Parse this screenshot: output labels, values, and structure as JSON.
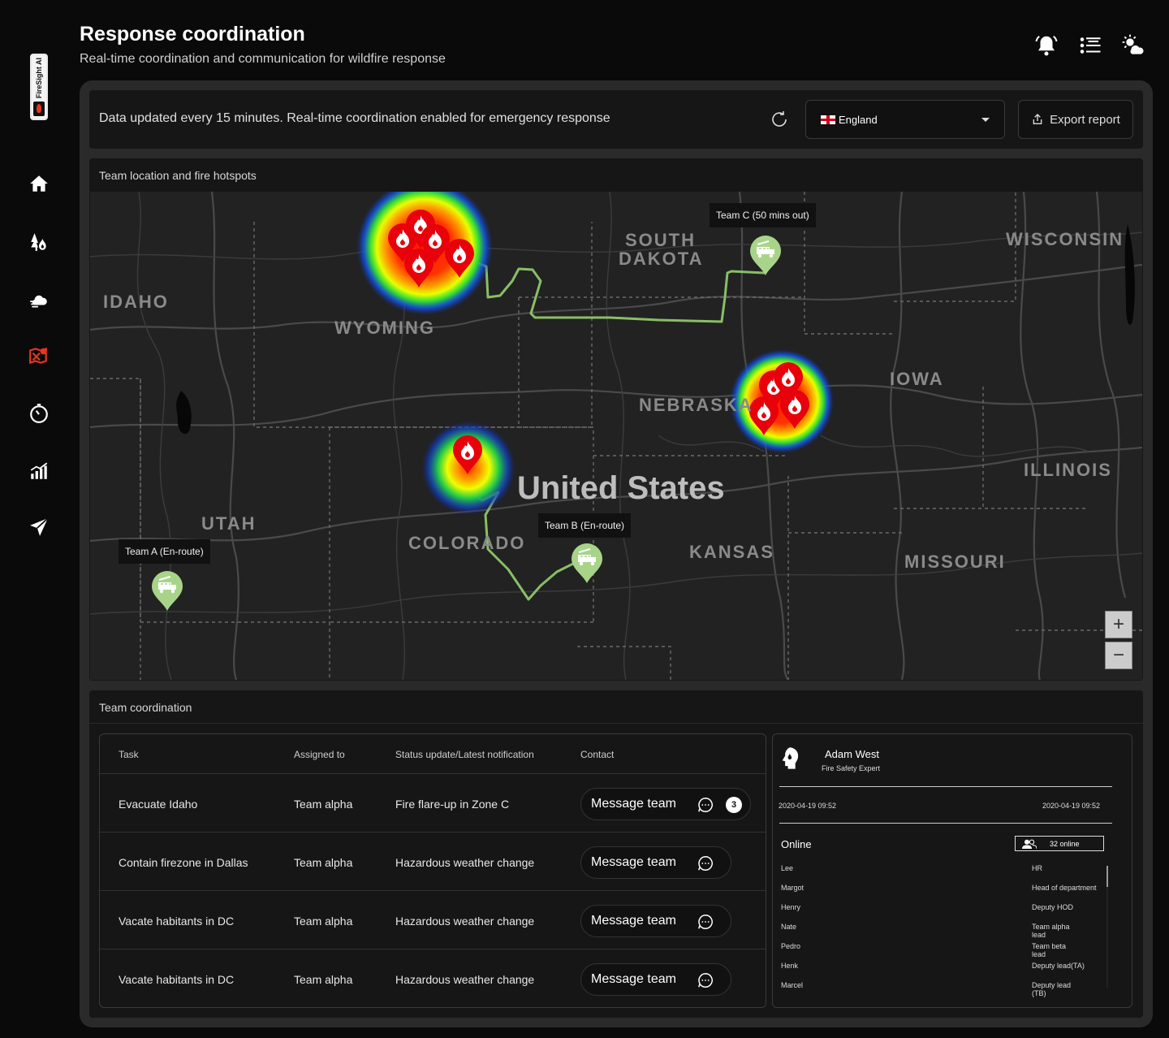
{
  "brand": {
    "name": "FireSight AI"
  },
  "header": {
    "title": "Response coordination",
    "subtitle": "Real-time coordination and communication for wildfire response"
  },
  "nav": [
    "home",
    "fire-risk",
    "weather",
    "response-map",
    "history",
    "analytics",
    "dispatch"
  ],
  "top_icons": [
    "bell-icon",
    "list-icon",
    "weather-icon"
  ],
  "info_bar": {
    "text": "Data updated every 15 minutes. Real-time coordination enabled for emergency response",
    "country": "England",
    "export_label": "Export report"
  },
  "map": {
    "title": "Team location and fire hotspots",
    "country_label": "United States",
    "states": [
      {
        "name": "IDAHO"
      },
      {
        "name": "WYOMING"
      },
      {
        "name": "SOUTH"
      },
      {
        "name": "DAKOTA"
      },
      {
        "name": "WISCONSIN"
      },
      {
        "name": "IOWA"
      },
      {
        "name": "NEBRASKA"
      },
      {
        "name": "ILLINOIS"
      },
      {
        "name": "UTAH"
      },
      {
        "name": "COLORADO"
      },
      {
        "name": "KANSAS"
      },
      {
        "name": "MISSOURI"
      }
    ],
    "teams": [
      {
        "label": "Team A (En-route)"
      },
      {
        "label": "Team B (En-route)"
      },
      {
        "label": "Team C (50 mins out)"
      }
    ],
    "zoom_in": "+",
    "zoom_out": "−"
  },
  "coordination": {
    "title": "Team coordination",
    "columns": [
      "Task",
      "Assigned to",
      "Status update/Latest notification",
      "Contact"
    ],
    "rows": [
      {
        "task": "Evacuate Idaho",
        "assigned": "Team alpha",
        "status": "Fire flare-up in Zone C",
        "contact": "Message team",
        "badge": "3"
      },
      {
        "task": "Contain firezone in Dallas",
        "assigned": "Team alpha",
        "status": "Hazardous weather change",
        "contact": "Message team"
      },
      {
        "task": "Vacate habitants in DC",
        "assigned": "Team alpha",
        "status": "Hazardous weather change",
        "contact": "Message team"
      },
      {
        "task": "Vacate habitants in DC",
        "assigned": "Team alpha",
        "status": "Hazardous weather change",
        "contact": "Message team"
      }
    ]
  },
  "profile": {
    "name": "Adam West",
    "role": "Fire Safety Expert",
    "date_left": "2020-04-19 09:52",
    "date_right": "2020-04-19 09:52",
    "online_title": "Online",
    "online_count": "32 online",
    "members": [
      {
        "name": "Lee",
        "role": "HR"
      },
      {
        "name": "Margot",
        "role": "Head of department"
      },
      {
        "name": "Henry",
        "role": "Deputy HOD"
      },
      {
        "name": "Nate",
        "role": "Team alpha lead"
      },
      {
        "name": "Pedro",
        "role": "Team beta lead"
      },
      {
        "name": "Henk",
        "role": "Deputy lead(TA)"
      },
      {
        "name": "Marcel",
        "role": "Deputy lead (TB)"
      }
    ]
  }
}
